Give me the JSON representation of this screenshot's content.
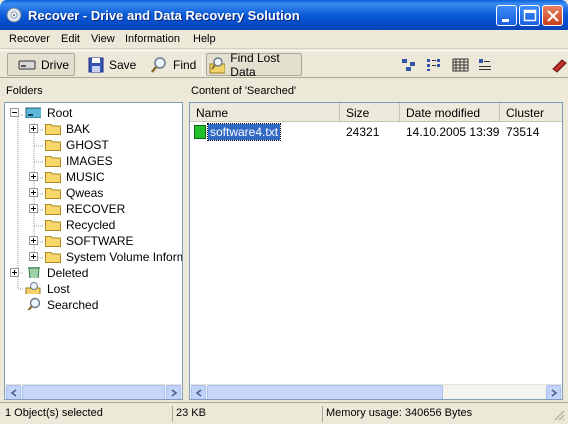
{
  "window": {
    "title": "Recover - Drive and Data Recovery Solution"
  },
  "menu": [
    "Recover",
    "Edit",
    "View",
    "Information",
    "Help"
  ],
  "toolbar": {
    "drive_label": "Drive",
    "save_label": "Save",
    "find_label": "Find",
    "find_lost_label": "Find Lost Data"
  },
  "folders_pane": {
    "header": "Folders",
    "root": "Root",
    "items": [
      "BAK",
      "GHOST",
      "IMAGES",
      "MUSIC",
      "Qweas",
      "RECOVER",
      "Recycled",
      "SOFTWARE",
      "System Volume Informati"
    ],
    "deleted": "Deleted",
    "lost": "Lost",
    "searched": "Searched"
  },
  "content_pane": {
    "header": "Content of 'Searched'",
    "columns": [
      "Name",
      "Size",
      "Date modified",
      "Cluster"
    ],
    "rows": [
      {
        "name": "software4.txt",
        "size": "24321",
        "date": "14.10.2005 13:39",
        "cluster": "73514"
      }
    ]
  },
  "status": {
    "selection": "1 Object(s) selected",
    "size": "23 KB",
    "memory": "Memory usage: 340656 Bytes"
  },
  "colors": {
    "title_bar": "#0b5ad6",
    "selection": "#316ac5",
    "file_icon": "#22c02a"
  }
}
